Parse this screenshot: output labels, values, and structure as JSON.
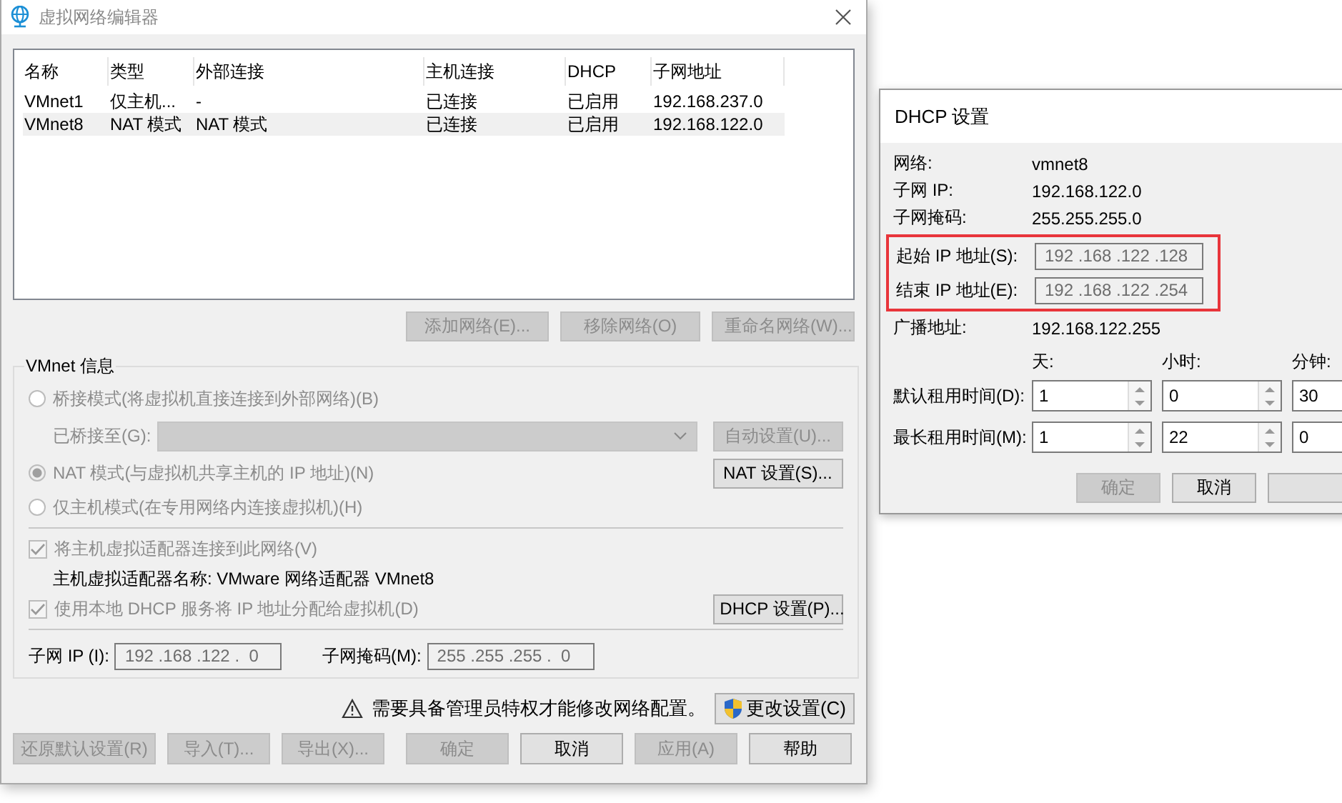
{
  "main_window": {
    "title": "虚拟网络编辑器",
    "table": {
      "columns": [
        "名称",
        "类型",
        "外部连接",
        "主机连接",
        "DHCP",
        "子网地址"
      ],
      "rows": [
        {
          "cells": [
            "VMnet1",
            "仅主机...",
            "-",
            "已连接",
            "已启用",
            "192.168.237.0"
          ],
          "selected": false
        },
        {
          "cells": [
            "VMnet8",
            "NAT 模式",
            "NAT 模式",
            "已连接",
            "已启用",
            "192.168.122.0"
          ],
          "selected": true
        }
      ]
    },
    "table_buttons": [
      {
        "label": "添加网络(E)...",
        "disabled": true
      },
      {
        "label": "移除网络(O)",
        "disabled": true
      },
      {
        "label": "重命名网络(W)...",
        "disabled": true
      }
    ],
    "vmnet_info": {
      "title": "VMnet 信息",
      "modes": [
        {
          "label": "桥接模式(将虚拟机直接连接到外部网络)(B)",
          "selected": false,
          "disabled": true
        },
        {
          "label": "NAT 模式(与虚拟机共享主机的 IP 地址)(N)",
          "selected": true,
          "disabled": true
        },
        {
          "label": "仅主机模式(在专用网络内连接虚拟机)(H)",
          "selected": false,
          "disabled": true
        }
      ],
      "bridged_to": {
        "label": "已桥接至(G):",
        "disabled": true
      },
      "auto_button": {
        "label": "自动设置(U)...",
        "disabled": true
      },
      "nat_button": {
        "label": "NAT 设置(S)...",
        "disabled": false
      },
      "connect_adapter": {
        "label": "将主机虚拟适配器连接到此网络(V)",
        "checked": true,
        "disabled": true
      },
      "adapter_name": "主机虚拟适配器名称: VMware 网络适配器 VMnet8",
      "use_dhcp": {
        "label": "使用本地 DHCP 服务将 IP 地址分配给虚拟机(D)",
        "checked": true,
        "disabled": true
      },
      "dhcp_button": {
        "label": "DHCP 设置(P)...",
        "disabled": false
      },
      "subnet_ip": {
        "label": "子网 IP (I):",
        "value": "192 .168 .122 .  0"
      },
      "subnet_mask": {
        "label": "子网掩码(M):",
        "value": "255 .255 .255 .  0"
      }
    },
    "warning": "需要具备管理员特权才能修改网络配置。",
    "change_button": {
      "label": "更改设置(C)",
      "disabled": false
    },
    "buttons": [
      {
        "label": "还原默认设置(R)",
        "disabled": true
      },
      {
        "label": "导入(T)...",
        "disabled": true
      },
      {
        "label": "导出(X)...",
        "disabled": true
      },
      {
        "label": "确定",
        "disabled": true
      },
      {
        "label": "取消",
        "disabled": false
      },
      {
        "label": "应用(A)",
        "disabled": true
      },
      {
        "label": "帮助",
        "disabled": false
      }
    ]
  },
  "dhcp_dialog": {
    "title": "DHCP 设置",
    "info": [
      {
        "label": "网络:",
        "value": "vmnet8"
      },
      {
        "label": "子网 IP:",
        "value": "192.168.122.0"
      },
      {
        "label": "子网掩码:",
        "value": "255.255.255.0"
      }
    ],
    "range": {
      "highlighted": true,
      "fields": [
        {
          "label": "起始 IP 地址(S):",
          "value": "192 .168 .122 .128"
        },
        {
          "label": "结束 IP 地址(E):",
          "value": "192 .168 .122 .254"
        }
      ]
    },
    "broadcast": {
      "label": "广播地址:",
      "value": "192.168.122.255"
    },
    "lease_columns": [
      "天:",
      "小时:",
      "分钟:"
    ],
    "lease_rows": [
      {
        "label": "默认租用时间(D):",
        "values": [
          "1",
          "0",
          "30"
        ]
      },
      {
        "label": "最长租用时间(M):",
        "values": [
          "1",
          "22",
          "0"
        ]
      }
    ],
    "buttons": [
      {
        "label": "确定",
        "disabled": true
      },
      {
        "label": "取消",
        "disabled": false
      },
      {
        "disabled": false
      }
    ]
  }
}
